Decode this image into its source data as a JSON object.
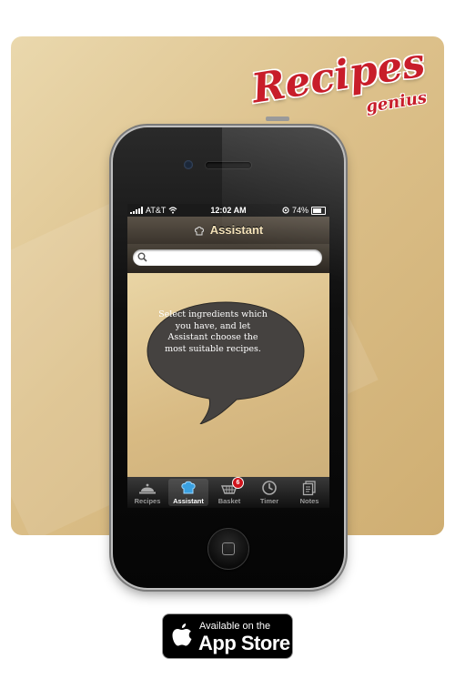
{
  "logo": {
    "main": "Recipes",
    "sub": "genius"
  },
  "statusbar": {
    "carrier": "AT&T",
    "time": "12:02 AM",
    "battery": "74%"
  },
  "navbar": {
    "title": "Assistant"
  },
  "search": {
    "value": "",
    "placeholder": ""
  },
  "bubble": {
    "text": "Select ingredients which you have, and let Assistant choose the most suitable recipes."
  },
  "tabbar": {
    "items": [
      {
        "label": "Recipes",
        "icon": "cloche-icon"
      },
      {
        "label": "Assistant",
        "icon": "chef-hat-icon",
        "active": true
      },
      {
        "label": "Basket",
        "icon": "basket-icon",
        "badge": "6"
      },
      {
        "label": "Timer",
        "icon": "clock-icon"
      },
      {
        "label": "Notes",
        "icon": "notes-icon"
      }
    ]
  },
  "appstore": {
    "line1": "Available on the",
    "line2": "App Store"
  },
  "colors": {
    "brand_red": "#c81d2a",
    "card_tan": "#dcc08a",
    "badge_red": "#d0141c",
    "nav_title": "#f4e2b8"
  }
}
